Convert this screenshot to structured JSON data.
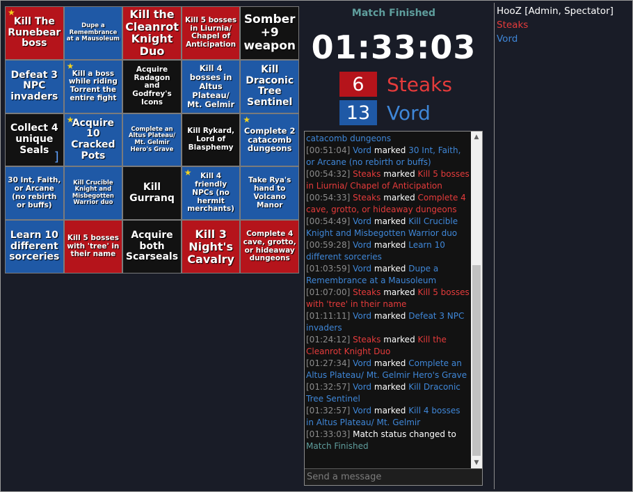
{
  "board": {
    "cells": [
      {
        "text": "Kill The Runebear boss",
        "color": "red",
        "star": true,
        "size": "fs-m"
      },
      {
        "text": "Dupe a Remembrance at a Mausoleum",
        "color": "blue",
        "star": false,
        "size": "fs-xxs"
      },
      {
        "text": "Kill the Cleanrot Knight Duo",
        "color": "red",
        "star": false,
        "size": "fs-l"
      },
      {
        "text": "Kill 5 bosses in Liurnia/ Chapel of Anticipation",
        "color": "red",
        "star": false,
        "size": "fs-xs"
      },
      {
        "text": "Somber +9 weapon",
        "color": "black",
        "star": false,
        "size": "fs-xl"
      },
      {
        "text": "Defeat 3 NPC invaders",
        "color": "blue",
        "star": false,
        "size": "fs-m"
      },
      {
        "text": "Kill a boss while riding Torrent the entire fight",
        "color": "blue",
        "star": true,
        "size": "fs-xs"
      },
      {
        "text": "Acquire Radagon and Godfrey's Icons",
        "color": "black",
        "star": false,
        "size": "fs-xs"
      },
      {
        "text": "Kill 4 bosses in Altus Plateau/ Mt. Gelmir",
        "color": "blue",
        "star": false,
        "size": "fs-s"
      },
      {
        "text": "Kill Draconic Tree Sentinel",
        "color": "blue",
        "star": false,
        "size": "fs-m"
      },
      {
        "text": "Collect 4 unique Seals",
        "color": "black",
        "star": false,
        "size": "fs-m",
        "mark": "]"
      },
      {
        "text": "Acquire 10 Cracked Pots",
        "color": "blue",
        "star": true,
        "size": "fs-m"
      },
      {
        "text": "Complete an Altus Plateau/ Mt. Gelmir Hero's Grave",
        "color": "blue",
        "star": false,
        "size": "fs-xxs"
      },
      {
        "text": "Kill Rykard, Lord of Blasphemy",
        "color": "black",
        "star": false,
        "size": "fs-xs"
      },
      {
        "text": "Complete 2 catacomb dungeons",
        "color": "blue",
        "star": true,
        "size": "fs-s"
      },
      {
        "text": "30 Int, Faith, or Arcane (no rebirth or buffs)",
        "color": "blue",
        "star": false,
        "size": "fs-xs"
      },
      {
        "text": "Kill Crucible Knight and Misbegotten Warrior duo",
        "color": "blue",
        "star": false,
        "size": "fs-xxs"
      },
      {
        "text": "Kill Gurranq",
        "color": "black",
        "star": false,
        "size": "fs-m"
      },
      {
        "text": "Kill 4 friendly NPCs (no hermit merchants)",
        "color": "blue",
        "star": true,
        "size": "fs-xs"
      },
      {
        "text": "Take Rya's hand to Volcano Manor",
        "color": "blue",
        "star": false,
        "size": "fs-xs"
      },
      {
        "text": "Learn 10 different sorceries",
        "color": "blue",
        "star": false,
        "size": "fs-m"
      },
      {
        "text": "Kill 5 bosses with 'tree' in their name",
        "color": "red",
        "star": false,
        "size": "fs-xs"
      },
      {
        "text": "Acquire both Scarseals",
        "color": "black",
        "star": false,
        "size": "fs-m"
      },
      {
        "text": "Kill 3 Night's Cavalry",
        "color": "red",
        "star": false,
        "size": "fs-l"
      },
      {
        "text": "Complete 4 cave, grotto, or hideaway dungeons",
        "color": "red",
        "star": false,
        "size": "fs-xs"
      }
    ]
  },
  "status": {
    "title": "Match Finished",
    "timer": "01:33:03"
  },
  "teams": [
    {
      "score": "6",
      "name": "Steaks",
      "color": "#b5141b",
      "text_color": "#e53b3b"
    },
    {
      "score": "13",
      "name": "Vord",
      "color": "#1f59a6",
      "text_color": "#3f87d8"
    }
  ],
  "chat": {
    "first_line": "catacomb dungeons",
    "messages": [
      {
        "time": "[00:51:04]",
        "player": "Vord",
        "team": "blue",
        "action": "marked",
        "goal": "30 Int, Faith, or Arcane (no rebirth or buffs)"
      },
      {
        "time": "[00:54:32]",
        "player": "Steaks",
        "team": "red",
        "action": "marked",
        "goal": "Kill 5 bosses in Liurnia/ Chapel of Anticipation"
      },
      {
        "time": "[00:54:33]",
        "player": "Steaks",
        "team": "red",
        "action": "marked",
        "goal": "Complete 4 cave, grotto, or hideaway dungeons"
      },
      {
        "time": "[00:54:49]",
        "player": "Vord",
        "team": "blue",
        "action": "marked",
        "goal": "Kill Crucible Knight and Misbegotten Warrior duo"
      },
      {
        "time": "[00:59:28]",
        "player": "Vord",
        "team": "blue",
        "action": "marked",
        "goal": "Learn 10 different sorceries"
      },
      {
        "time": "[01:03:59]",
        "player": "Vord",
        "team": "blue",
        "action": "marked",
        "goal": "Dupe a Remembrance at a Mausoleum"
      },
      {
        "time": "[01:07:00]",
        "player": "Steaks",
        "team": "red",
        "action": "marked",
        "goal": "Kill 5 bosses with 'tree' in their name"
      },
      {
        "time": "[01:11:11]",
        "player": "Vord",
        "team": "blue",
        "action": "marked",
        "goal": "Defeat 3 NPC invaders"
      },
      {
        "time": "[01:24:12]",
        "player": "Steaks",
        "team": "red",
        "action": "marked",
        "goal": "Kill the Cleanrot Knight Duo"
      },
      {
        "time": "[01:27:34]",
        "player": "Vord",
        "team": "blue",
        "action": "marked",
        "goal": "Complete an Altus Plateau/ Mt. Gelmir Hero's Grave"
      },
      {
        "time": "[01:32:57]",
        "player": "Vord",
        "team": "blue",
        "action": "marked",
        "goal": "Kill Draconic Tree Sentinel"
      },
      {
        "time": "[01:32:57]",
        "player": "Vord",
        "team": "blue",
        "action": "marked",
        "goal": "Kill 4 bosses in Altus Plateau/ Mt. Gelmir"
      }
    ],
    "final": {
      "time": "[01:33:03]",
      "text": "Match status changed to",
      "status": "Match Finished"
    },
    "input_placeholder": "Send a message"
  },
  "players": [
    {
      "name": "HooZ [Admin, Spectator]",
      "color": "white"
    },
    {
      "name": "Steaks",
      "color": "red"
    },
    {
      "name": "Vord",
      "color": "blue"
    }
  ],
  "icons": {
    "star": "star-icon",
    "scroll_up": "chevron-up-icon",
    "scroll_down": "chevron-down-icon"
  }
}
